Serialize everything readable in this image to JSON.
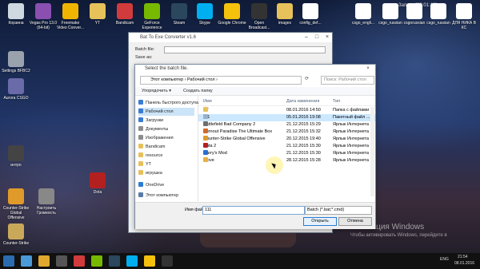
{
  "desktop": {
    "icons": [
      {
        "label": "Корзина",
        "color": "#cfd8e0"
      },
      {
        "label": "Vegas Pro 13.0 (64-bit)",
        "color": "#8a4fb0"
      },
      {
        "label": "Freemake Video Conver...",
        "color": "#f0b400"
      },
      {
        "label": "YT",
        "color": "#e7c15a"
      },
      {
        "label": "Bandicam",
        "color": "#d23b3b"
      },
      {
        "label": "GeForce Experience",
        "color": "#76b900"
      },
      {
        "label": "Steam",
        "color": "#2a475e"
      },
      {
        "label": "Skype",
        "color": "#00aff0"
      },
      {
        "label": "Google Chrome",
        "color": "#f4c20d"
      },
      {
        "label": "Open Broadcast...",
        "color": "#333333"
      },
      {
        "label": "images",
        "color": "#e7c15a"
      },
      {
        "label": "config_def...",
        "color": "#ffffff"
      },
      {
        "label": "csgo_engli...",
        "color": "#ffffff"
      },
      {
        "label": "csgo_russian",
        "color": "#ffffff"
      },
      {
        "label": "csgorussian",
        "color": "#ffffff"
      },
      {
        "label": "csgo_russian",
        "color": "#ffffff"
      },
      {
        "label": "ДЛЯ НИКА В КС",
        "color": "#ffffff"
      },
      {
        "label": "Settings BFBC2",
        "color": "#9aa3ad"
      },
      {
        "label": "Aurora CSGO",
        "color": "#6a6aa8"
      },
      {
        "label": "интро",
        "color": "#444444"
      },
      {
        "label": "Dota",
        "color": "#b32020"
      },
      {
        "label": "Counter-Strike Global Offensive",
        "color": "#e09a2a"
      },
      {
        "label": "Настроить Громкость",
        "color": "#888888"
      },
      {
        "label": "Counter-Strike",
        "color": "#caa85a"
      }
    ],
    "watermark": {
      "title": "Активация Windows",
      "subtitle": "Чтобы активировать Windows, перейдите в"
    },
    "corner_label": "Запись [00:01:13]"
  },
  "taskbar": {
    "clock_time": "21:54",
    "clock_date": "08.01.2016",
    "lang": "ENG",
    "colors": [
      "#2b6cb0",
      "#4a9ad8",
      "#e0a82e",
      "#555555",
      "#d23b3b",
      "#76b900",
      "#2a475e",
      "#00aff0",
      "#f4c20d",
      "#333333"
    ]
  },
  "app": {
    "title": "Bat To Exe Converter v1.6",
    "batch_label": "Batch file:",
    "save_label": "Save as:"
  },
  "dialog": {
    "title": "Select the batch file.",
    "address": "Этот компьютер › Рабочий стол ›",
    "search_placeholder": "Поиск: Рабочий стол",
    "organize": "Упорядочить ▾",
    "new_folder": "Создать папку",
    "nav": [
      {
        "label": "Панель быстрого доступа",
        "color": "#3a7bd5"
      },
      {
        "label": "Рабочий стол",
        "color": "#3a7bd5",
        "selected": true
      },
      {
        "label": "Загрузки",
        "color": "#3a7bd5"
      },
      {
        "label": "Документы",
        "color": "#8c8c8c"
      },
      {
        "label": "Изображения",
        "color": "#8c8c8c"
      },
      {
        "label": "Bandicam",
        "color": "#e7c15a"
      },
      {
        "label": "resource",
        "color": "#e7c15a"
      },
      {
        "label": "YT",
        "color": "#e7c15a"
      },
      {
        "label": "игрушка",
        "color": "#e7c15a"
      },
      {
        "label": "OneDrive",
        "color": "#2a7bd6"
      },
      {
        "label": "Этот компьютер",
        "color": "#5a7ba8"
      }
    ],
    "columns": {
      "name": "Имя",
      "date": "Дата изменения",
      "type": "Тип"
    },
    "files": [
      {
        "name": "YT",
        "date": "08.01.2016 14:50",
        "type": "Папка с файлами",
        "color": "#e7c15a"
      },
      {
        "name": "111",
        "date": "05.01.2016 19:08",
        "type": "Пакетный файл ...",
        "color": "#9ab0c8",
        "selected": true
      },
      {
        "name": "Battlefield Bad Company 2",
        "date": "21.12.2015 15:29",
        "type": "Ярлык Интернета",
        "color": "#6f6f6f"
      },
      {
        "name": "Burnout Paradise The Ultimate Box",
        "date": "21.12.2015 15:32",
        "type": "Ярлык Интернета",
        "color": "#d06a2a"
      },
      {
        "name": "Counter-Strike Global Offensive",
        "date": "20.12.2015 19:40",
        "type": "Ярлык Интернета",
        "color": "#e09a2a"
      },
      {
        "name": "Dota 2",
        "date": "21.12.2015 15:30",
        "type": "Ярлык Интернета",
        "color": "#b32020"
      },
      {
        "name": "Garry's Mod",
        "date": "21.12.2015 15:30",
        "type": "Ярлык Интернета",
        "color": "#2a6fd6"
      },
      {
        "name": "Trove",
        "date": "28.12.2015 15:28",
        "type": "Ярлык Интернета",
        "color": "#e8b040"
      }
    ],
    "filename_label": "Имя файла:",
    "filename_value": "111",
    "filetype_value": "Batch (*.bat;*.cmd)",
    "open_label": "Открыть",
    "cancel_label": "Отмена"
  }
}
